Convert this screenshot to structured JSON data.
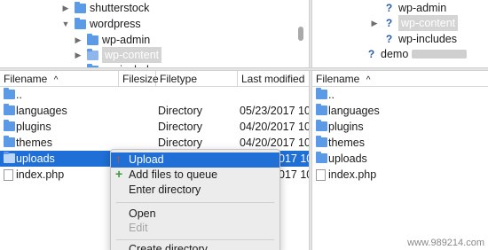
{
  "local_tree": {
    "nodes": [
      "shutterstock",
      "wordpress",
      "wp-admin",
      "wp-content",
      "wp-includes"
    ]
  },
  "remote_tree": {
    "nodes": [
      "wp-admin",
      "wp-content",
      "wp-includes",
      "demo"
    ]
  },
  "local_list": {
    "columns": [
      "Filename",
      "Filesize",
      "Filetype",
      "Last modified"
    ],
    "rows": [
      {
        "name": "..",
        "type": "",
        "modified": ""
      },
      {
        "name": "languages",
        "type": "Directory",
        "modified": "05/23/2017 10"
      },
      {
        "name": "plugins",
        "type": "Directory",
        "modified": "04/20/2017 10"
      },
      {
        "name": "themes",
        "type": "Directory",
        "modified": "04/20/2017 10"
      },
      {
        "name": "uploads",
        "type": "",
        "modified": "017 10"
      },
      {
        "name": "index.php",
        "type": "",
        "modified": "017 10"
      }
    ]
  },
  "remote_list": {
    "columns": [
      "Filename"
    ],
    "rows": [
      "..",
      "languages",
      "plugins",
      "themes",
      "uploads",
      "index.php"
    ]
  },
  "context_menu": {
    "items": [
      "Upload",
      "Add files to queue",
      "Enter directory",
      "Open",
      "Edit",
      "Create directory"
    ]
  },
  "watermark": "www.989214.com"
}
